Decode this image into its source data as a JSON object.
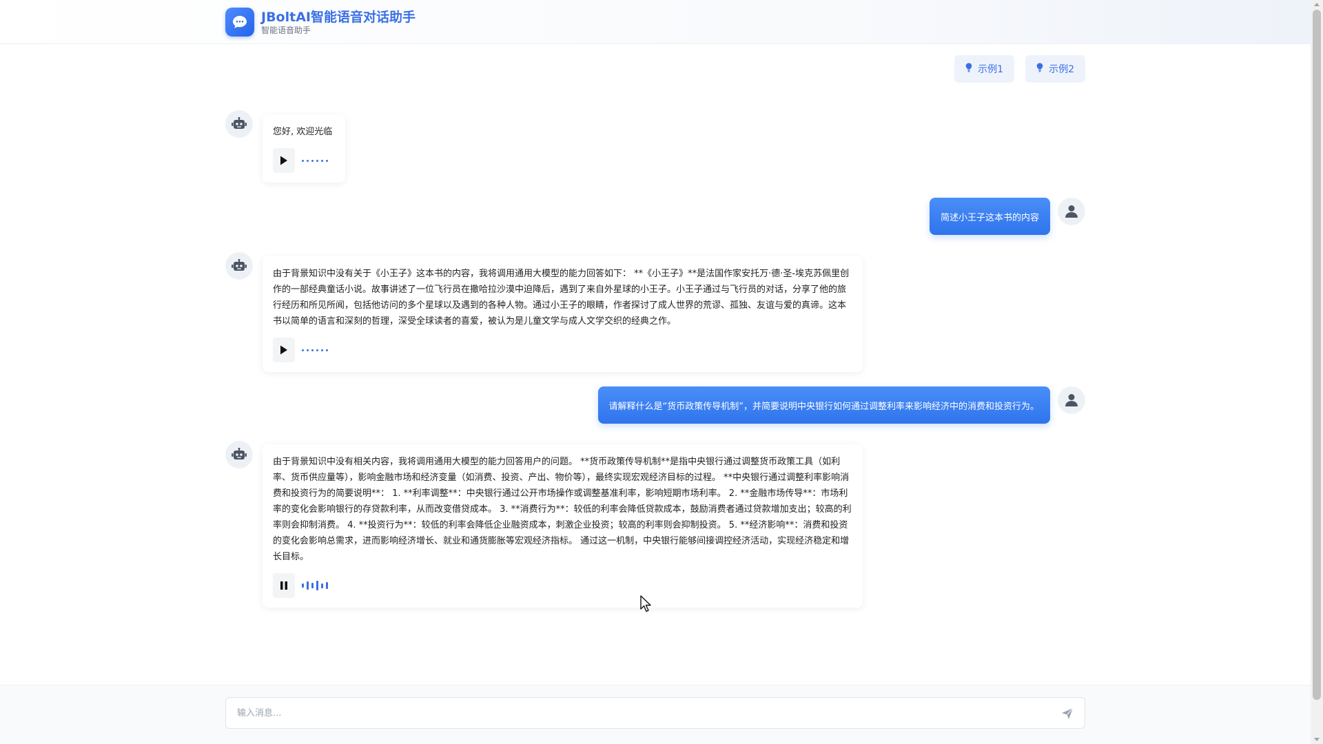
{
  "header": {
    "title": "JBoltAI智能语音对话助手",
    "subtitle": "智能语音助手",
    "logo_icon": "chat-bubble-icon"
  },
  "examples": [
    {
      "label": "示例1",
      "icon": "lightbulb-icon"
    },
    {
      "label": "示例2",
      "icon": "lightbulb-icon"
    }
  ],
  "messages": [
    {
      "role": "assistant",
      "text": "您好, 欢迎光临",
      "audio_state": "paused"
    },
    {
      "role": "user",
      "text": "简述小王子这本书的内容"
    },
    {
      "role": "assistant",
      "text": "由于背景知识中没有关于《小王子》这本书的内容，我将调用通用大模型的能力回答如下： **《小王子》**是法国作家安托万·德·圣-埃克苏佩里创作的一部经典童话小说。故事讲述了一位飞行员在撒哈拉沙漠中迫降后，遇到了来自外星球的小王子。小王子通过与飞行员的对话，分享了他的旅行经历和所见所闻，包括他访问的多个星球以及遇到的各种人物。通过小王子的眼睛，作者探讨了成人世界的荒谬、孤独、友谊与爱的真谛。这本书以简单的语言和深刻的哲理，深受全球读者的喜爱，被认为是儿童文学与成人文学交织的经典之作。",
      "audio_state": "paused"
    },
    {
      "role": "user",
      "text": "请解释什么是“货币政策传导机制”，并简要说明中央银行如何通过调整利率来影响经济中的消费和投资行为。"
    },
    {
      "role": "assistant",
      "text": "由于背景知识中没有相关内容，我将调用通用大模型的能力回答用户的问题。 **货币政策传导机制**是指中央银行通过调整货币政策工具（如利率、货币供应量等），影响金融市场和经济变量（如消费、投资、产出、物价等），最终实现宏观经济目标的过程。 **中央银行通过调整利率影响消费和投资行为的简要说明**： 1. **利率调整**：中央银行通过公开市场操作或调整基准利率，影响短期市场利率。 2. **金融市场传导**：市场利率的变化会影响银行的存贷款利率，从而改变借贷成本。 3. **消费行为**：较低的利率会降低贷款成本，鼓励消费者通过贷款增加支出；较高的利率则会抑制消费。 4. **投资行为**：较低的利率会降低企业融资成本，刺激企业投资；较高的利率则会抑制投资。 5. **经济影响**：消费和投资的变化会影响总需求，进而影响经济增长、就业和通货膨胀等宏观经济指标。 通过这一机制，中央银行能够间接调控经济活动，实现经济稳定和增长目标。",
      "audio_state": "playing"
    }
  ],
  "input": {
    "placeholder": "输入消息...",
    "value": "",
    "send_icon": "send-icon"
  },
  "colors": {
    "accent": "#3b6fe6",
    "user_bubble": "#3b82f6",
    "avatar_bg": "#edf1f6"
  }
}
